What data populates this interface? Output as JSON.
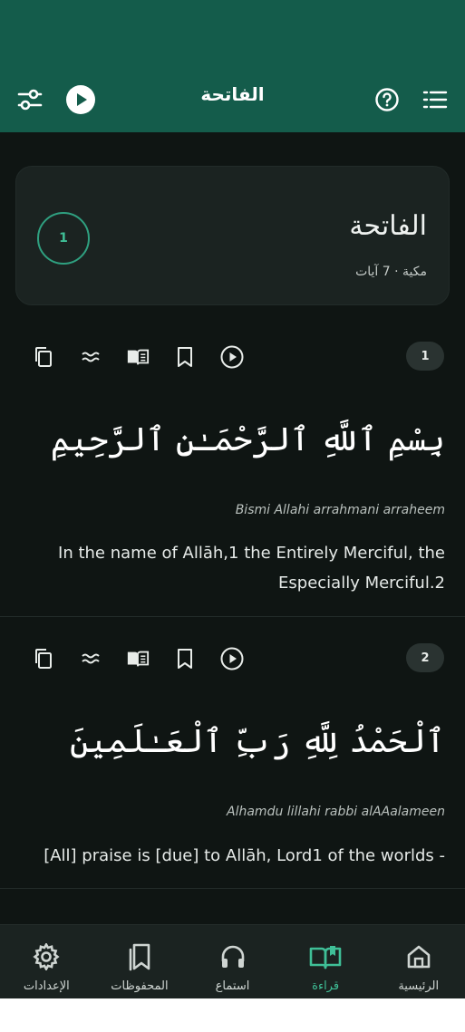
{
  "app": {
    "title": "الفاتحة",
    "accent": "#145c4b",
    "highlight": "#3fbf97"
  },
  "appbar": {
    "left_icons": [
      "settings-sliders-icon",
      "play-circle-icon"
    ],
    "right_icons": [
      "help-circle-icon",
      "list-icon"
    ]
  },
  "surah": {
    "number": "1",
    "name": "الفاتحة",
    "meta": "مكية · 7 آيات"
  },
  "verses": [
    {
      "number": "1",
      "arabic": "بِسْمِ ٱللَّهِ ٱلرَّحْمَـٰنِ ٱلرَّحِيمِ",
      "transliteration": "Bismi Allahi arrahmani arraheem",
      "translation": "In the name of Allāh,1 the Entirely Merciful, the Especially Merciful.2"
    },
    {
      "number": "2",
      "arabic": "ٱلْحَمْدُ لِلَّهِ رَبِّ ٱلْعَـٰلَمِينَ",
      "transliteration": "Alhamdu lillahi rabbi alAAalameen",
      "translation": "[All] praise is [due] to Allāh, Lord1 of the worlds -"
    }
  ],
  "verse_actions": [
    "copy-icon",
    "wave-icon",
    "book-open-icon",
    "bookmark-icon",
    "play-circle-icon"
  ],
  "bottom_nav": [
    {
      "label": "الرئيسية",
      "icon": "home-icon",
      "active": false
    },
    {
      "label": "قراءة",
      "icon": "book-open-icon",
      "active": true
    },
    {
      "label": "استماع",
      "icon": "headphones-icon",
      "active": false
    },
    {
      "label": "المحفوظات",
      "icon": "bookmarks-icon",
      "active": false
    },
    {
      "label": "الإعدادات",
      "icon": "gear-icon",
      "active": false
    }
  ]
}
